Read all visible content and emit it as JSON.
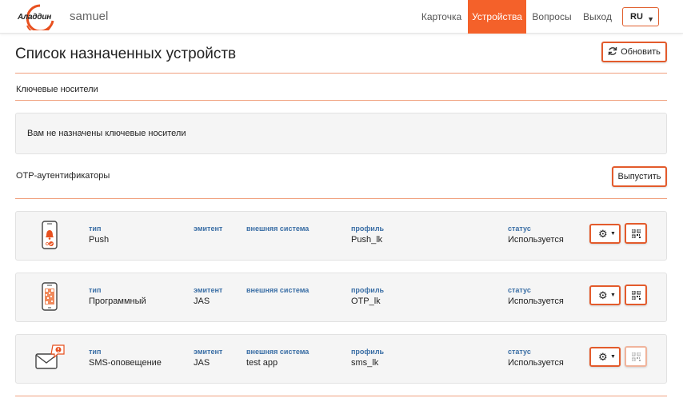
{
  "header": {
    "logo_text": "Аладдин",
    "username": "samuel",
    "nav": [
      {
        "label": "Карточка"
      },
      {
        "label": "Устройства",
        "active": true
      },
      {
        "label": "Вопросы"
      },
      {
        "label": "Выход"
      }
    ],
    "language": {
      "selected": "RU"
    }
  },
  "page": {
    "title": "Список назначенных устройств",
    "refresh_label": "Обновить"
  },
  "key_carriers": {
    "title": "Ключевые носители",
    "empty_message": "Вам не назначены ключевые носители"
  },
  "otp": {
    "title": "OTP-аутентификаторы",
    "issue_label": "Выпустить",
    "columns": {
      "type": "тип",
      "issuer": "эмитент",
      "external_system": "внешняя система",
      "profile": "профиль",
      "status": "статус"
    },
    "devices": [
      {
        "icon": "push-phone-icon",
        "type": "Push",
        "issuer": "",
        "external_system": "",
        "profile": "Push_lk",
        "status": "Используется",
        "qr_enabled": true
      },
      {
        "icon": "software-token-icon",
        "type": "Программный",
        "issuer": "JAS",
        "external_system": "",
        "profile": "OTP_lk",
        "status": "Используется",
        "qr_enabled": true
      },
      {
        "icon": "sms-envelope-icon",
        "type": "SMS-оповещение",
        "issuer": "JAS",
        "external_system": "test app",
        "profile": "sms_lk",
        "status": "Используется",
        "qr_enabled": false
      }
    ]
  },
  "colors": {
    "accent": "#f4612a",
    "label_blue": "#3a6ea5",
    "card_bg": "#f5f5f5"
  }
}
